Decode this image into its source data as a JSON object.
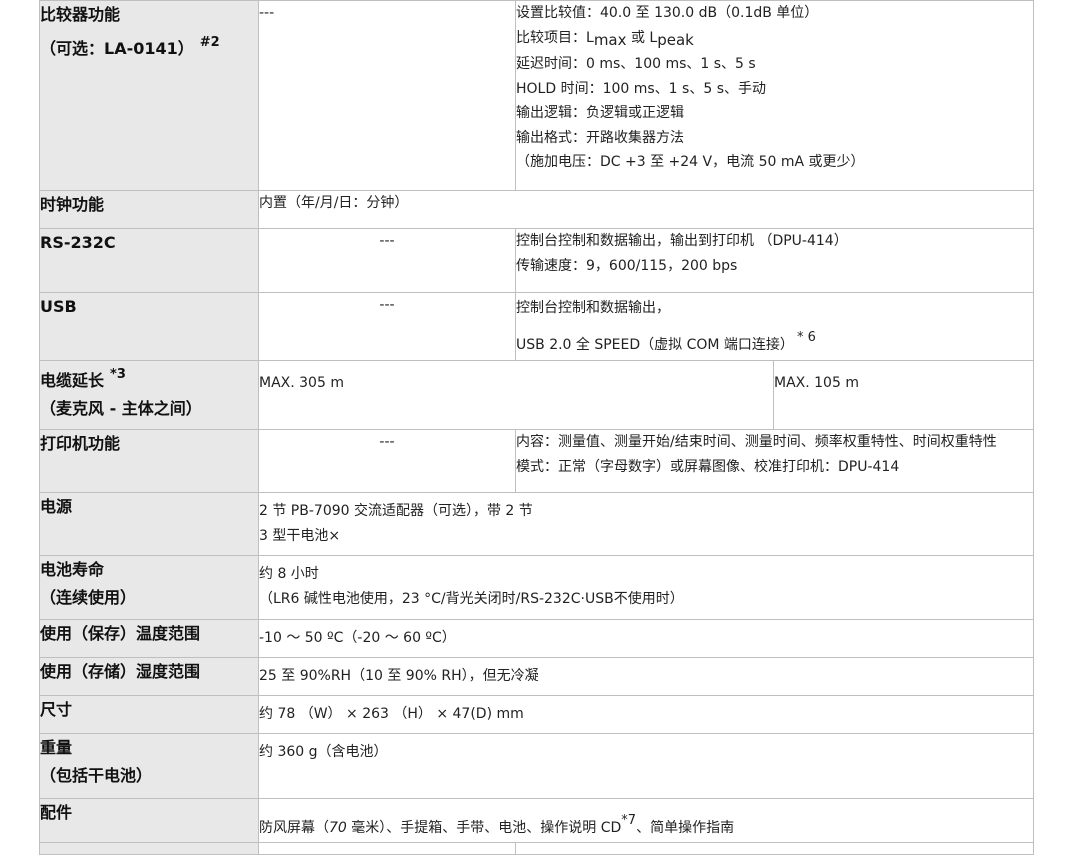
{
  "rows": {
    "comparator": {
      "label": [
        "比较器功能",
        "（可选：LA-0141）"
      ],
      "note": "#2",
      "col2": "---",
      "col3": {
        "l1": "设置比较值：40.0 至 130.0 dB（0.1dB 单位）",
        "l2_prefix": "比较项目：L",
        "l2_sub1": "max",
        "l2_mid": " 或 L",
        "l2_sub2": "peak",
        "l3": "延迟时间：0 ms、100 ms、1 s、5 s",
        "l4": "HOLD 时间：100 ms、1 s、5 s、手动",
        "l5": "输出逻辑：负逻辑或正逻辑",
        "l6": "输出格式：开路收集器方法",
        "l7": "（施加电压：DC +3 至 +24 V，电流 50 mA 或更少）"
      }
    },
    "clock": {
      "label": "时钟功能",
      "value": "内置（年/月/日：分钟）"
    },
    "rs232c": {
      "label": "RS-232C",
      "col2": "---",
      "lines": [
        "控制台控制和数据输出，输出到打印机 （DPU-414）",
        "传输速度：9，600/115，200 bps"
      ]
    },
    "usb": {
      "label": "USB",
      "col2": "---",
      "line1": "控制台控制和数据输出，",
      "line2": "USB 2.0 全 SPEED（虚拟 COM 端口连接）",
      "note": "* 6"
    },
    "cable": {
      "label": [
        "电缆延长",
        "（麦克风 - 主体之间）"
      ],
      "note": "*3",
      "col2": "MAX. 305 m",
      "col3": "MAX. 105 m"
    },
    "printer": {
      "label": "打印机功能",
      "col2": "---",
      "lines": [
        "内容：测量值、测量开始/结束时间、测量时间、频率权重特性、时间权重特性",
        "模式：正常（字母数字）或屏幕图像、校准打印机：DPU-414"
      ]
    },
    "power": {
      "label": "电源",
      "lines": [
        "2 节 PB-7090 交流适配器（可选），带 2 节",
        "3 型干电池×"
      ]
    },
    "battery": {
      "label": [
        "电池寿命",
        "（连续使用）"
      ],
      "lines": [
        "约 8 小时",
        "（LR6 碱性电池使用，23 °C/背光关闭时/RS-232C·USB不使用时）"
      ]
    },
    "temp": {
      "label": "使用（保存）温度范围",
      "value": "-10 ～ 50 ºC（-20 ～ 60 ºC）"
    },
    "humidity": {
      "label": "使用（存储）湿度范围",
      "value": "25 至 90%RH（10 至 90% RH），但无冷凝"
    },
    "size": {
      "label": "尺寸",
      "value": "约 78 （W） × 263 （H） × 47(D) mm"
    },
    "weight": {
      "label": [
        "重量",
        "（包括干电池）"
      ],
      "value": "约 360 g（含电池）"
    },
    "accessories": {
      "label": "配件",
      "prefix": "防风屏幕（",
      "italic": "70",
      "mid": " 毫米）、手提箱、手带、电池、操作说明 CD",
      "note": "*7",
      "suffix": "、简单操作指南"
    }
  }
}
